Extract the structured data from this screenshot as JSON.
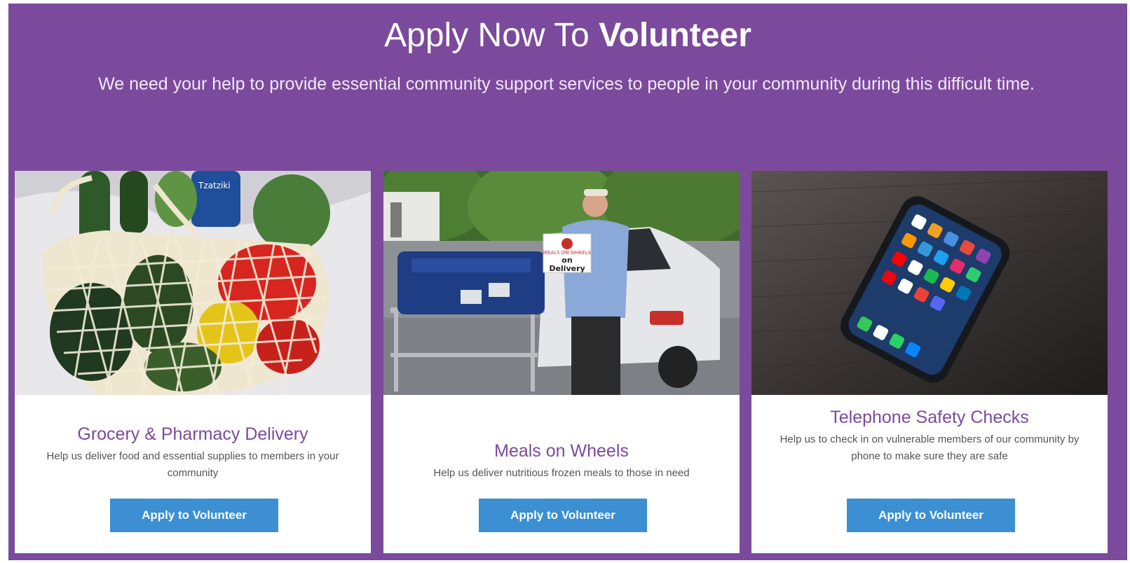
{
  "hero": {
    "title_prefix": "Apply Now To",
    "title_emphasis": "Volunteer",
    "subtitle": "We need your help to provide essential community support services to people in your community during this difficult time."
  },
  "cards": [
    {
      "title": "Grocery & Pharmacy Delivery",
      "description": "Help us deliver food and essential supplies to members in your community",
      "button": "Apply to Volunteer",
      "image_icon": "grocery-bag-photo"
    },
    {
      "title": "Meals on Wheels",
      "description": "Help us deliver nutritious frozen meals to those in need",
      "button": "Apply to Volunteer",
      "image_icon": "volunteer-with-delivery-photo",
      "sign_line1": "MEALS ON WHEELS",
      "sign_line2": "on",
      "sign_line3": "Delivery"
    },
    {
      "title": "Telephone Safety Checks",
      "description": "Help us to check in on vulnerable members of our community by phone to make sure they are safe",
      "button": "Apply to Volunteer",
      "image_icon": "smartphone-photo"
    }
  ],
  "colors": {
    "background": "#7b4a9c",
    "card_title": "#7b4a9c",
    "button": "#3b8fd2"
  }
}
